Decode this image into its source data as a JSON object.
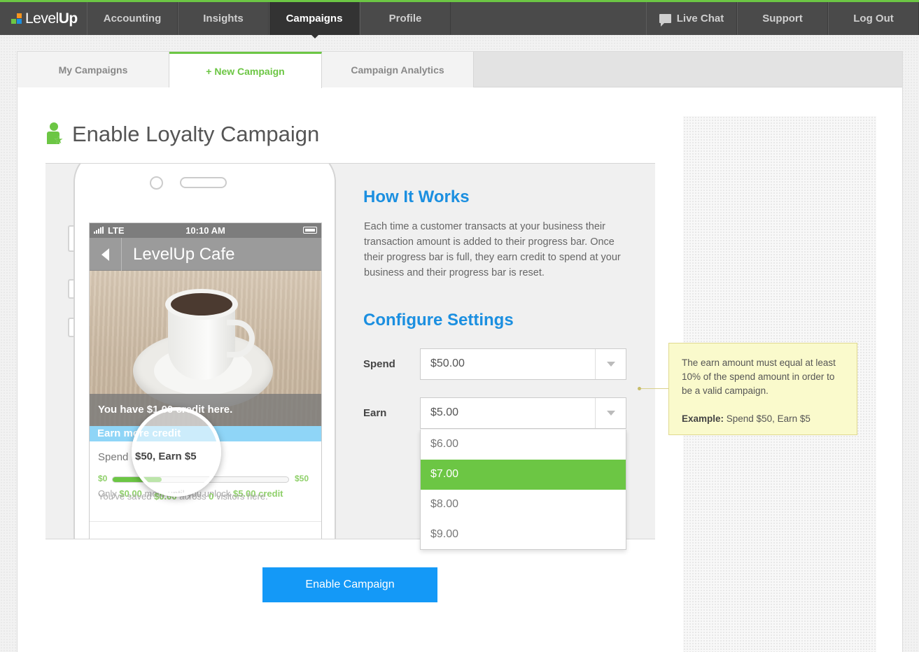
{
  "brand": {
    "logo_light": "Level",
    "logo_bold": "Up",
    "accent": "#6cc644",
    "blue": "#1499f7"
  },
  "nav": {
    "items": [
      "Accounting",
      "Insights",
      "Campaigns",
      "Profile"
    ],
    "active": "Campaigns",
    "right": {
      "live_chat": "Live Chat",
      "support": "Support",
      "logout": "Log Out"
    }
  },
  "tabs": [
    {
      "label": "My Campaigns"
    },
    {
      "label": "+ New Campaign",
      "active": true
    },
    {
      "label": "Campaign Analytics"
    }
  ],
  "page": {
    "title": "Enable Loyalty Campaign",
    "icon": "person-star-icon"
  },
  "phone": {
    "carrier": "LTE",
    "time": "10:10 AM",
    "app_title": "LevelUp Cafe",
    "credit_msg": "You have $1.00 credit here.",
    "earn_more": "Earn more credit",
    "spend_line": "Spend $50, Earn $5",
    "spend_prefix": "Spend",
    "mag_text": "$50, Earn $5",
    "progress_min": "$0",
    "progress_max": "$50",
    "progress_fraction": 0.28,
    "only_a": "Only ",
    "only_amount": "$0.00",
    "only_b": " more until you unlock ",
    "only_credit": "$5.00 credit",
    "saved_a": "You've saved ",
    "saved_amount": "$0.00",
    "saved_b": " across ",
    "saved_count": "0",
    "saved_c": " visitors here."
  },
  "how_it_works": {
    "heading": "How It Works",
    "text": "Each time a customer transacts at your business their transaction amount is added to their progress bar. Once their progress bar is full, they earn credit to spend at your business and their progress bar is reset."
  },
  "configure": {
    "heading": "Configure Settings",
    "spend_label": "Spend",
    "spend_value": "$50.00",
    "earn_label": "Earn",
    "earn_value": "$5.00",
    "earn_options": [
      "$6.00",
      "$7.00",
      "$8.00",
      "$9.00"
    ],
    "earn_highlighted": "$7.00"
  },
  "note": {
    "text": "The earn amount must equal at least 10% of the spend amount in order to be a valid campaign.",
    "example_label": "Example:",
    "example_text": " Spend $50, Earn $5"
  },
  "actions": {
    "enable": "Enable Campaign"
  }
}
